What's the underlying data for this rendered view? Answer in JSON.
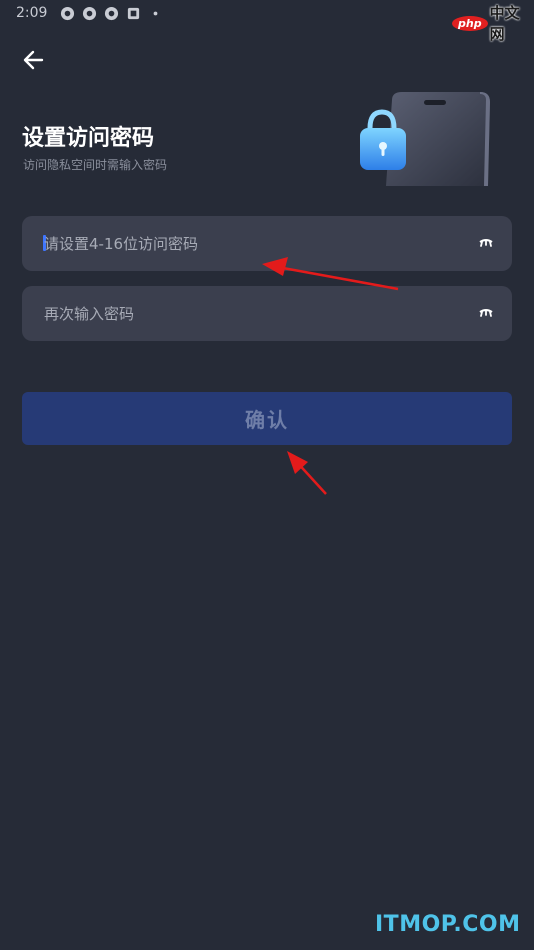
{
  "status_bar": {
    "time": "2:09",
    "icons": [
      "notification-icon",
      "notification-icon",
      "notification-icon",
      "app-icon",
      "dot-icon"
    ]
  },
  "header": {
    "title": "设置访问密码",
    "subtitle": "访问隐私空间时需输入密码"
  },
  "form": {
    "password_placeholder": "请设置4-16位访问密码",
    "password_value": "",
    "confirm_placeholder": "再次输入密码",
    "confirm_value": "",
    "visibility_icon": "eye-closed-icon"
  },
  "actions": {
    "confirm_label": "确认"
  },
  "watermarks": {
    "top_logo": "php",
    "top_text": "中文网",
    "bottom": "ITMOP.COM"
  },
  "colors": {
    "background": "#262b37",
    "field": "#3b3f4e",
    "button": "#263a76",
    "annotation_arrow": "#e31b1b"
  }
}
